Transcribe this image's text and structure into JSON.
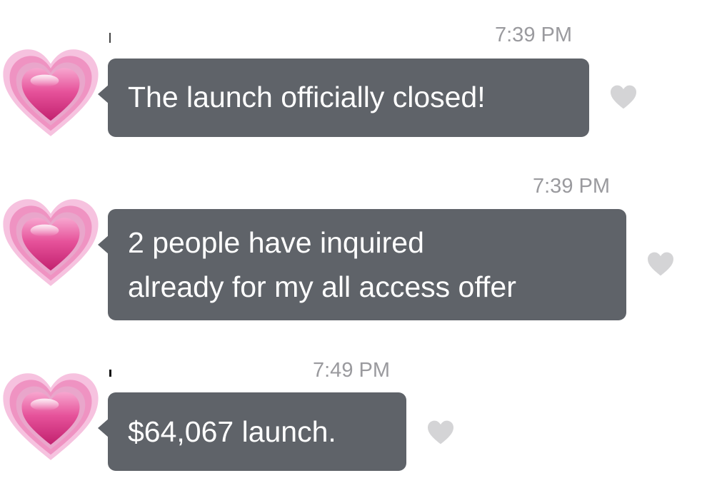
{
  "messages": [
    {
      "timestamp": "7:39 PM",
      "text": "The launch officially closed!",
      "avatar_icon": "growing-heart-emoji",
      "like_icon": "heart-icon"
    },
    {
      "timestamp": "7:39 PM",
      "text": "2 people have inquired\nalready for my all access offer",
      "avatar_icon": "growing-heart-emoji",
      "like_icon": "heart-icon"
    },
    {
      "timestamp": "7:49 PM",
      "text": "$64,067 launch.",
      "avatar_icon": "growing-heart-emoji",
      "like_icon": "heart-icon"
    }
  ],
  "colors": {
    "bubble": "#5f6369",
    "bubble_text": "#ffffff",
    "timestamp": "#9a9a9e",
    "like_heart": "#d4d4d6",
    "avatar_heart_outer": "#f3b9d8",
    "avatar_heart_inner": "#e0408f"
  }
}
